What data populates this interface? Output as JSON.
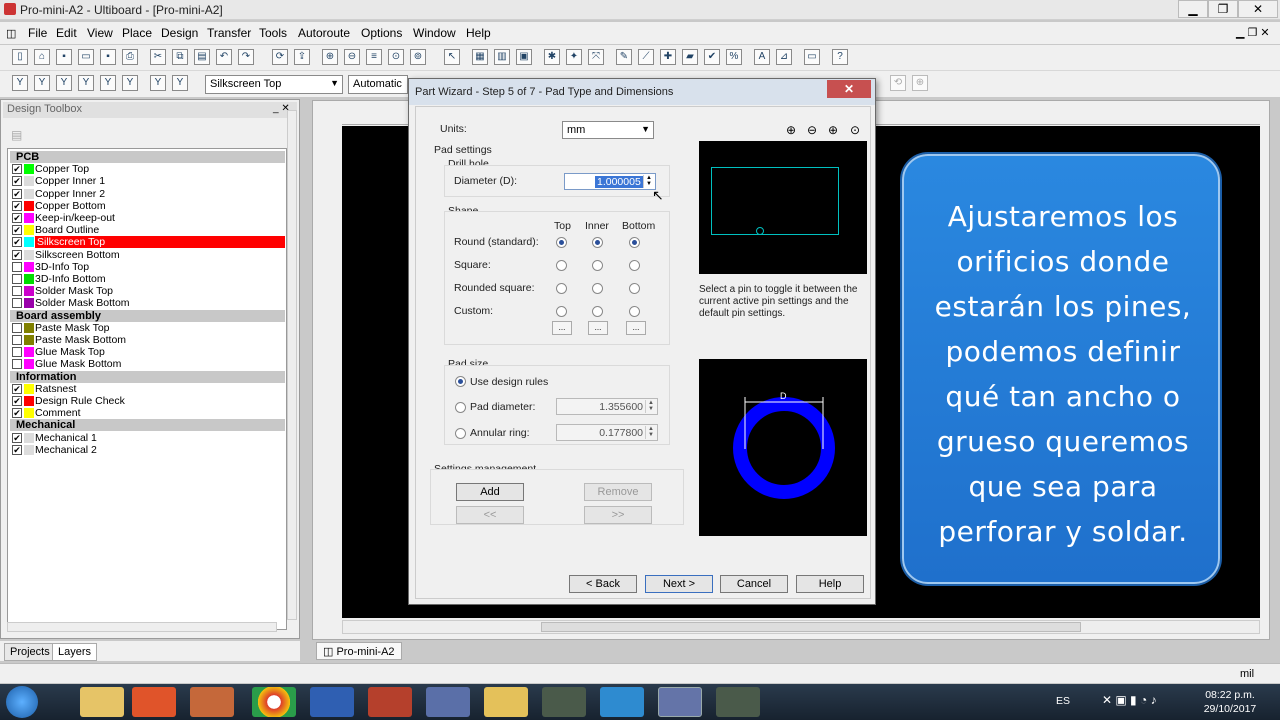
{
  "window": {
    "title": "Pro-mini-A2 - Ultiboard - [Pro-mini-A2]"
  },
  "menu": [
    "File",
    "Edit",
    "View",
    "Place",
    "Design",
    "Transfer",
    "Tools",
    "Autoroute",
    "Options",
    "Window",
    "Help"
  ],
  "toolbar": {
    "layer_combo": "Silkscreen Top",
    "mode_combo": "Automatic"
  },
  "toolbox": {
    "title": "Design Toolbox",
    "groups": [
      {
        "name": "PCB",
        "items": [
          {
            "name": "Copper Top",
            "color": "#00ff00",
            "checked": true
          },
          {
            "name": "Copper Inner 1",
            "color": "#dcdcdc",
            "checked": true
          },
          {
            "name": "Copper Inner 2",
            "color": "#dcdcdc",
            "checked": true
          },
          {
            "name": "Copper Bottom",
            "color": "#ff0000",
            "checked": true
          },
          {
            "name": "Keep-in/keep-out",
            "color": "#ff00ff",
            "checked": true
          },
          {
            "name": "Board Outline",
            "color": "#ffff00",
            "checked": true
          },
          {
            "name": "Silkscreen Top",
            "color": "#00ffff",
            "checked": true,
            "selected": true
          },
          {
            "name": "Silkscreen Bottom",
            "color": "#dcdcdc",
            "checked": true
          },
          {
            "name": "3D-Info Top",
            "color": "#ff00ff",
            "checked": false
          },
          {
            "name": "3D-Info Bottom",
            "color": "#00dd00",
            "checked": false
          },
          {
            "name": "Solder Mask Top",
            "color": "#cc00cc",
            "checked": false
          },
          {
            "name": "Solder Mask Bottom",
            "color": "#9900aa",
            "checked": false
          }
        ]
      },
      {
        "name": "Board assembly",
        "items": [
          {
            "name": "Paste Mask Top",
            "color": "#808000",
            "checked": false
          },
          {
            "name": "Paste Mask Bottom",
            "color": "#808000",
            "checked": false
          },
          {
            "name": "Glue Mask Top",
            "color": "#ff00ff",
            "checked": false
          },
          {
            "name": "Glue Mask Bottom",
            "color": "#ff00ff",
            "checked": false
          }
        ]
      },
      {
        "name": "Information",
        "items": [
          {
            "name": "Ratsnest",
            "color": "#ffff00",
            "checked": true
          },
          {
            "name": "Design Rule Check",
            "color": "#ff0000",
            "checked": true
          },
          {
            "name": "Comment",
            "color": "#ffff00",
            "checked": true
          }
        ]
      },
      {
        "name": "Mechanical",
        "items": [
          {
            "name": "Mechanical 1",
            "color": "#dcdcdc",
            "checked": true
          },
          {
            "name": "Mechanical 2",
            "color": "#dcdcdc",
            "checked": true
          }
        ]
      }
    ],
    "tabs": [
      "Projects",
      "Layers"
    ]
  },
  "doc_tab": "Pro-mini-A2",
  "dialog": {
    "title": "Part Wizard - Step 5 of 7 - Pad Type and Dimensions",
    "units_label": "Units:",
    "units_value": "mm",
    "pad_settings": "Pad settings",
    "drill_hole": "Drill hole",
    "diameter_label": "Diameter (D):",
    "diameter_value": "1.000005",
    "shape": "Shape",
    "cols": [
      "Top",
      "Inner",
      "Bottom"
    ],
    "rows": [
      "Round (standard):",
      "Square:",
      "Rounded square:",
      "Custom:"
    ],
    "dots": "...",
    "pad_size": "Pad size",
    "use_design_rules": "Use design rules",
    "pad_diameter_label": "Pad diameter:",
    "pad_diameter_value": "1.355600",
    "annular_label": "Annular ring:",
    "annular_value": "0.177800",
    "settings_mgmt": "Settings management",
    "add": "Add",
    "remove": "Remove",
    "prev_set": "<<",
    "next_set": ">>",
    "hint": "Select a pin to toggle it between the current active pin settings and the default pin settings.",
    "dim_label": "D",
    "back": "< Back",
    "next": "Next >",
    "cancel": "Cancel",
    "help": "Help"
  },
  "callout": {
    "text": "Ajustaremos los orificios donde estarán los pines, podemos definir qué tan ancho o grueso queremos que sea para perforar y soldar."
  },
  "status": {
    "unit": "mil"
  },
  "taskbar": {
    "lang": "ES",
    "time": "08:22 p.m.",
    "date": "29/10/2017"
  }
}
